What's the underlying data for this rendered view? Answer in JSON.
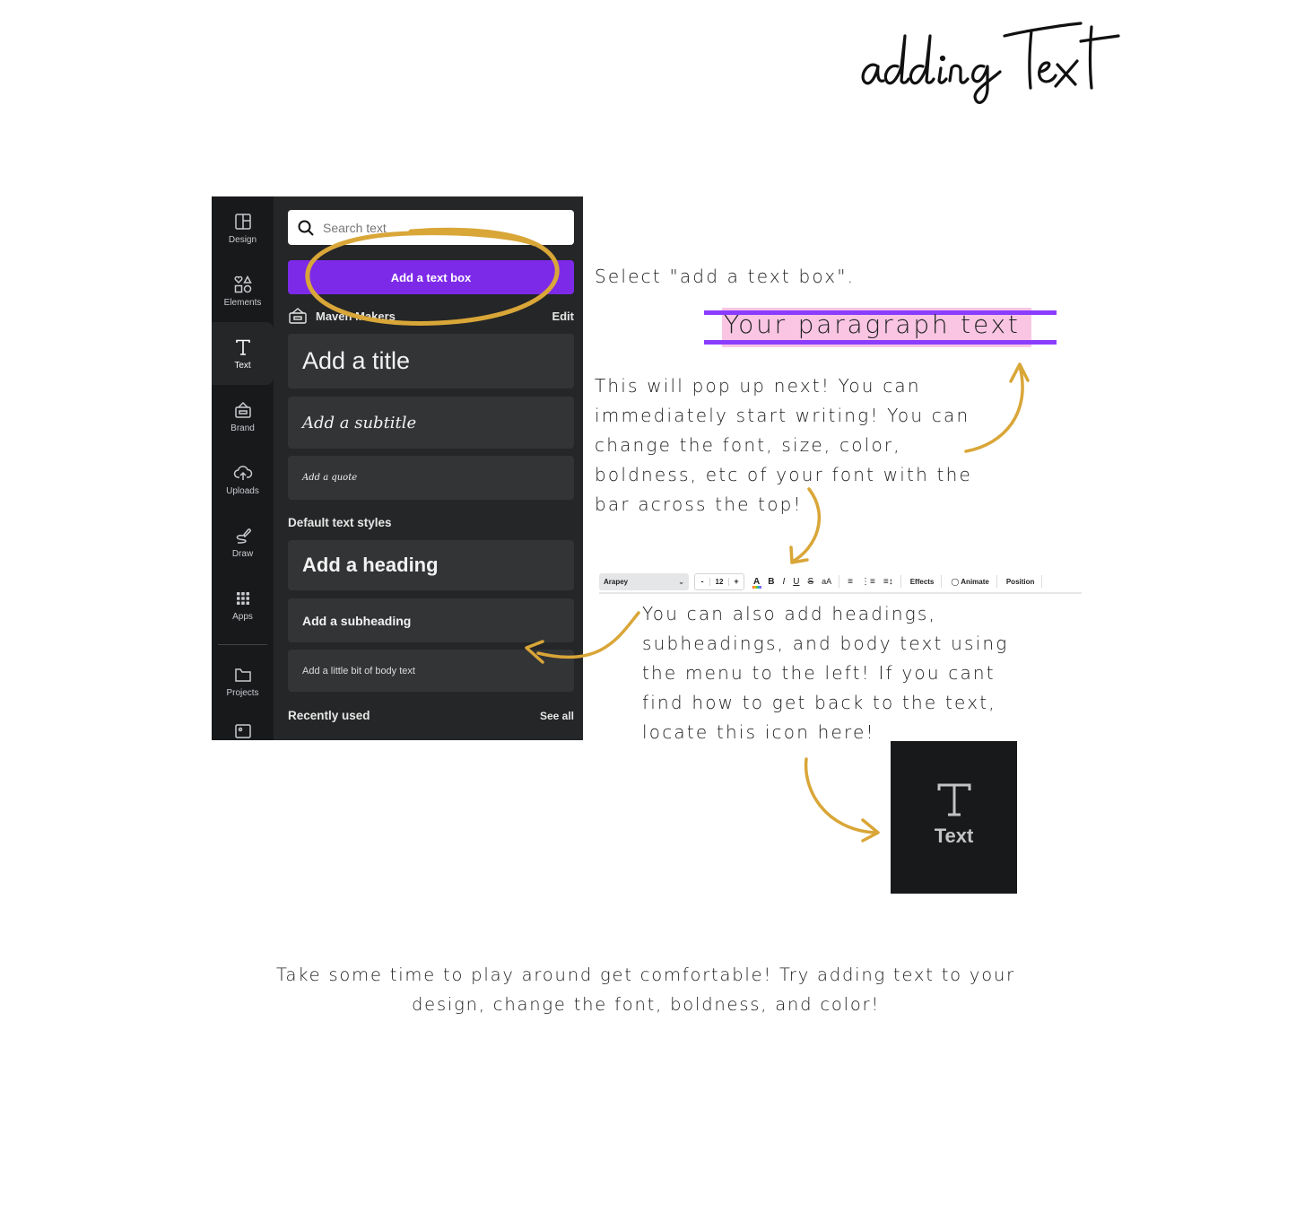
{
  "page": {
    "title": "adding Text",
    "accent_color": "#d9a638"
  },
  "canva_panel": {
    "rail": [
      {
        "label": "Design",
        "icon": "layout-icon"
      },
      {
        "label": "Elements",
        "icon": "shapes-icon"
      },
      {
        "label": "Text",
        "icon": "text-t-icon",
        "active": true
      },
      {
        "label": "Brand",
        "icon": "brand-kit-icon"
      },
      {
        "label": "Uploads",
        "icon": "cloud-upload-icon"
      },
      {
        "label": "Draw",
        "icon": "draw-icon"
      },
      {
        "label": "Apps",
        "icon": "apps-grid-icon"
      },
      {
        "label": "Projects",
        "icon": "folder-icon"
      }
    ],
    "search_placeholder": "Search text",
    "add_text_box_label": "Add a text box",
    "brand_kit_name": "Maven Makers",
    "brand_edit_label": "Edit",
    "presets": {
      "title": "Add a title",
      "subtitle": "Add a subtitle",
      "quote": "Add a quote"
    },
    "default_styles_label": "Default text styles",
    "styles": {
      "heading": "Add a heading",
      "subheading": "Add a subheading",
      "body": "Add a little bit of body text"
    },
    "recently_used_label": "Recently used",
    "see_all_label": "See all",
    "brand_color": "#7d2ae8"
  },
  "instructions": {
    "select": "Select \"add a text box\".",
    "popup": "This will pop up next! You can immediately start writing! You can change the font, size, color, boldness, etc of your font with the bar across the top!",
    "also": "You can also add headings, subheadings, and body text using the menu to the left! If you cant find how to get back to the text, locate this icon here!",
    "bottom": "Take some time to play around get comfortable! Try adding text to your design, change the font, boldness, and color!"
  },
  "paragraph_preview": {
    "text": "Your paragraph text",
    "selection_color": "#8b3dff",
    "highlight_color": "#f9c5e3"
  },
  "toolbar": {
    "font": "Arapey",
    "font_size": "12",
    "decrease": "-",
    "increase": "+",
    "color_label": "A",
    "bold": "B",
    "italic": "I",
    "underline": "U",
    "strikethrough": "S",
    "case": "aA",
    "effects": "Effects",
    "animate": "Animate",
    "position": "Position"
  },
  "text_icon_box": {
    "label": "Text"
  }
}
